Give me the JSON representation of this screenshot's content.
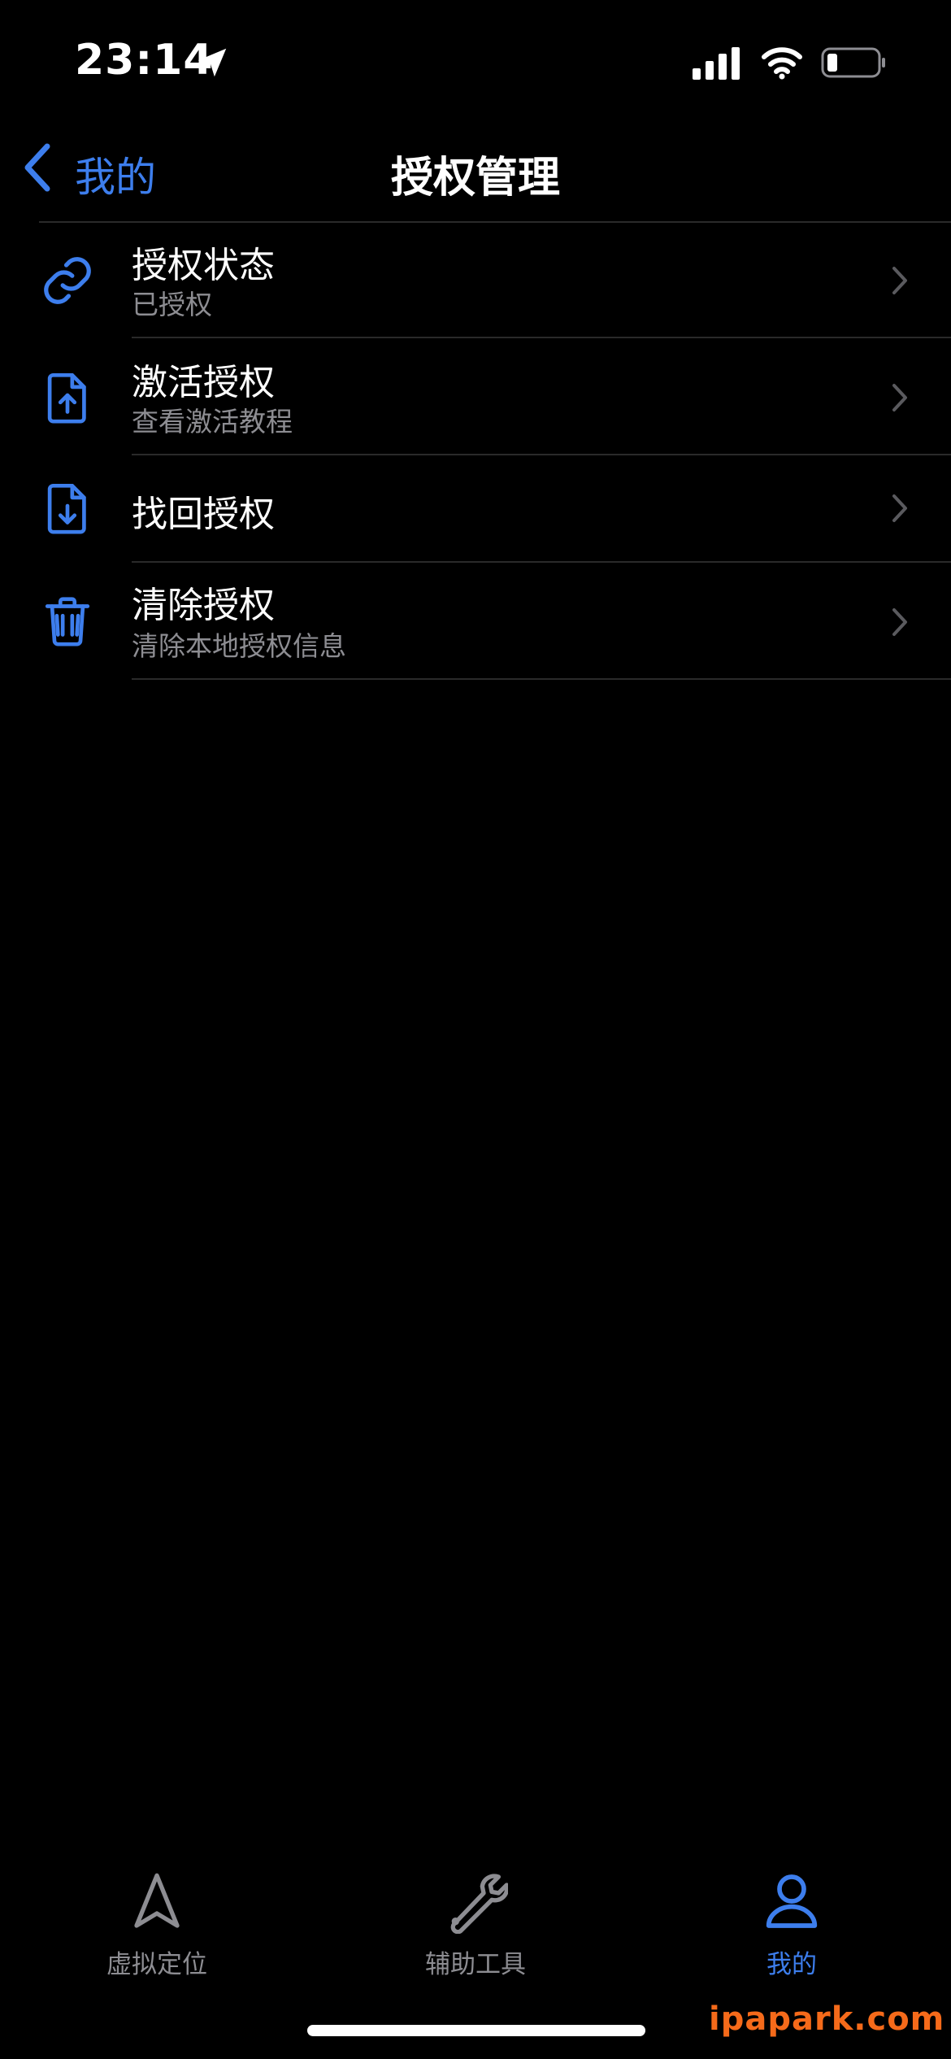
{
  "status_bar": {
    "time": "23:14",
    "location_icon": "location-arrow-icon",
    "signal_icon": "cellular-signal-icon",
    "wifi_icon": "wifi-icon",
    "battery_icon": "battery-low-icon"
  },
  "nav": {
    "back_label": "我的",
    "title": "授权管理"
  },
  "list": [
    {
      "icon": "link-icon",
      "title": "授权状态",
      "subtitle": "已授权"
    },
    {
      "icon": "document-upload-icon",
      "title": "激活授权",
      "subtitle": "查看激活教程"
    },
    {
      "icon": "document-download-icon",
      "title": "找回授权",
      "subtitle": ""
    },
    {
      "icon": "trash-icon",
      "title": "清除授权",
      "subtitle": "清除本地授权信息"
    }
  ],
  "tabs": [
    {
      "icon": "navigation-arrow-icon",
      "label": "虚拟定位",
      "active": false
    },
    {
      "icon": "wrench-icon",
      "label": "辅助工具",
      "active": false
    },
    {
      "icon": "person-icon",
      "label": "我的",
      "active": true
    }
  ],
  "colors": {
    "accent": "#3d7eed",
    "inactive": "#8d8d92",
    "background": "#000000",
    "separator": "#2a2a2a"
  },
  "watermark": "ipapark.com"
}
